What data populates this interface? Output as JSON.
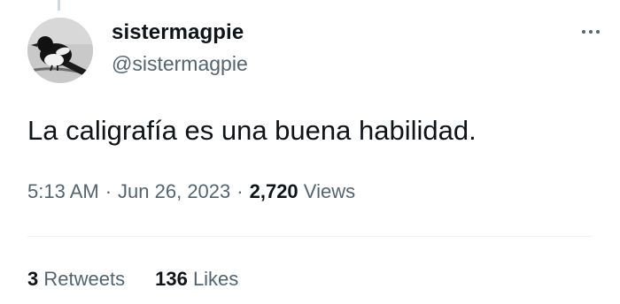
{
  "tweet": {
    "author": {
      "display_name": "sistermagpie",
      "handle": "@sistermagpie",
      "avatar": "magpie-bird-avatar"
    },
    "text": "La caligrafía es una buena habilidad.",
    "time": "5:13 AM",
    "separator": "·",
    "date": "Jun 26, 2023",
    "views_count": "2,720",
    "views_label": "Views",
    "retweets_count": "3",
    "retweets_label": "Retweets",
    "likes_count": "136",
    "likes_label": "Likes"
  },
  "icons": {
    "more": "more-horizontal-icon"
  },
  "colors": {
    "primary_text": "#0f1419",
    "secondary_text": "#536471",
    "divider": "#eff3f4",
    "thread_line": "#cfd9de"
  }
}
